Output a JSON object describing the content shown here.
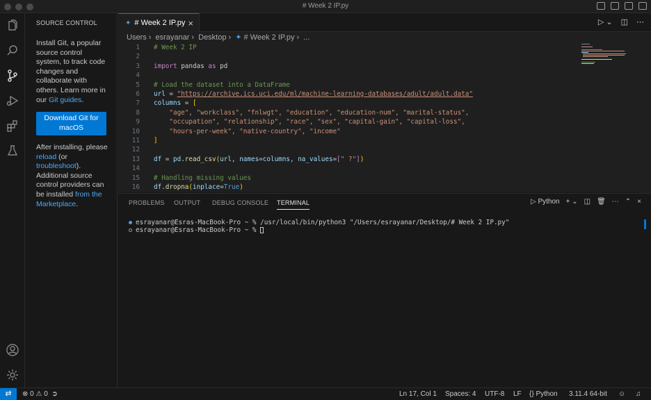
{
  "window": {
    "title": "# Week 2 IP.py"
  },
  "activity_bar": {
    "items": [
      "explorer-icon",
      "search-icon",
      "source-control-icon",
      "run-debug-icon",
      "extensions-icon",
      "testing-icon"
    ],
    "bottom": [
      "account-icon",
      "manage-gear-icon"
    ]
  },
  "sidebar": {
    "header": "SOURCE CONTROL",
    "intro_text": "Install Git, a popular source control system, to track code changes and collaborate with others. Learn more in our ",
    "intro_link": "Git guides",
    "intro_end": ".",
    "download_button": "Download Git for macOS",
    "after_1": "After installing, please ",
    "reload_link": "reload",
    "after_2": " (or ",
    "troubleshoot_link": "troubleshoot",
    "after_3": "). Additional source control providers can be installed ",
    "marketplace_link": "from the Marketplace",
    "after_4": "."
  },
  "editor": {
    "tab_label": "# Week 2 IP.py",
    "breadcrumb": [
      "Users",
      "esrayanar",
      "Desktop",
      "# Week 2 IP.py",
      "..."
    ],
    "lines": [
      {
        "n": "1"
      },
      {
        "n": "2"
      },
      {
        "n": "3"
      },
      {
        "n": "4"
      },
      {
        "n": "5"
      },
      {
        "n": "6"
      },
      {
        "n": "7"
      },
      {
        "n": "8"
      },
      {
        "n": "9"
      },
      {
        "n": "10"
      },
      {
        "n": "11"
      },
      {
        "n": "12"
      },
      {
        "n": "13"
      },
      {
        "n": "14"
      },
      {
        "n": "15"
      },
      {
        "n": "16"
      }
    ],
    "code": {
      "l1": "# Week 2 IP",
      "l3_kw": "import",
      "l3_mod": " pandas ",
      "l3_as": "as",
      "l3_alias": " pd",
      "l5": "# Load the dataset into a DataFrame",
      "l6_var": "url",
      "l6_eq": " = ",
      "l6_url": "\"https://archive.ics.uci.edu/ml/machine-learning-databases/adult/adult.data\"",
      "l7_var": "columns",
      "l7_eq": " = ",
      "l7_br": "[",
      "l8": "    \"age\", \"workclass\", \"fnlwgt\", \"education\", \"education-num\", \"marital-status\",",
      "l9": "    \"occupation\", \"relationship\", \"race\", \"sex\", \"capital-gain\", \"capital-loss\",",
      "l10": "    \"hours-per-week\", \"native-country\", \"income\"",
      "l11": "]",
      "l13_df": "df",
      "l13_eq": " = ",
      "l13_pd": "pd",
      "l13_fn": ".read_csv",
      "l13_open": "(",
      "l13_url": "url",
      "l13_c1": ", ",
      "l13_names": "names",
      "l13_eq2": "=",
      "l13_cols": "columns",
      "l13_c2": ", ",
      "l13_na": "na_values",
      "l13_eq3": "=",
      "l13_lb": "[",
      "l13_q": "\" ?\"",
      "l13_rb": "]",
      "l13_close": ")",
      "l15": "# Handling missing values",
      "l16_df": "df",
      "l16_fn": ".dropna",
      "l16_open": "(",
      "l16_arg": "inplace",
      "l16_eq": "=",
      "l16_true": "True",
      "l16_close": ")"
    }
  },
  "panel": {
    "tabs": [
      "PROBLEMS",
      "OUTPUT",
      "DEBUG CONSOLE",
      "TERMINAL"
    ],
    "active_tab": "TERMINAL",
    "terminal_profile": "Python",
    "terminal_lines": [
      "esrayanar@Esras-MacBook-Pro ~ % /usr/local/bin/python3 \"/Users/esrayanar/Desktop/# Week 2 IP.py\"",
      "esrayanar@Esras-MacBook-Pro ~ % "
    ]
  },
  "status_bar": {
    "errors": "0",
    "warnings": "0",
    "position": "Ln 17, Col 1",
    "spaces": "Spaces: 4",
    "encoding": "UTF-8",
    "eol": "LF",
    "language": "Python",
    "interpreter": "3.11.4 64-bit"
  },
  "colors": {
    "accent": "#0078d4",
    "link": "#4daafc",
    "background": "#181818",
    "editor_bg": "#1f1f1f"
  }
}
